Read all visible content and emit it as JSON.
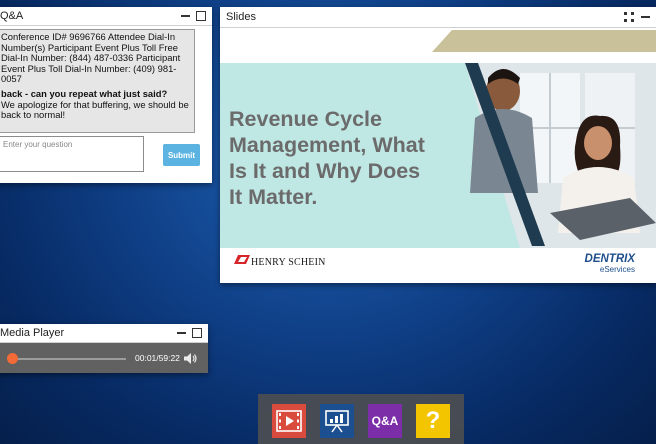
{
  "qa": {
    "title": "Q&A",
    "log_line1": "Conference ID# 9696766 Attendee Dial-In Number(s) Participant Event Plus Toll Free Dial-In Number: (844) 487-0336 Participant Event Plus Toll Dial-In Number: (409) 981-0057",
    "log_q": "back - can you repeat what just said?",
    "log_a": "We apologize for that buffering, we should be back to normal!",
    "input_placeholder": "Enter your question",
    "submit_label": "Submit"
  },
  "slides": {
    "title": "Slides",
    "slide_title_l1": "Revenue Cycle",
    "slide_title_l2": "Management, What",
    "slide_title_l3": "Is It and Why Does",
    "slide_title_l4": "It Matter.",
    "logo_left": "HENRY SCHEIN",
    "logo_right_top": "DENTRIX",
    "logo_right_bottom": "eServices"
  },
  "media": {
    "title": "Media Player",
    "time": "00:01/59:22",
    "progress": 0.03
  },
  "dock": {
    "qa_label": "Q&A",
    "help_label": "?"
  },
  "colors": {
    "accent_blue": "#5ab3e0",
    "slide_teal": "#bfe7e4",
    "slide_tan": "#c9c19a",
    "slide_text": "#6b6b6b",
    "dock_slides": "#1b4f8f",
    "dock_qa": "#7b2ea8",
    "dock_help": "#f2c500",
    "dock_video": "#d94b3c",
    "progress_orange": "#f26a37"
  }
}
